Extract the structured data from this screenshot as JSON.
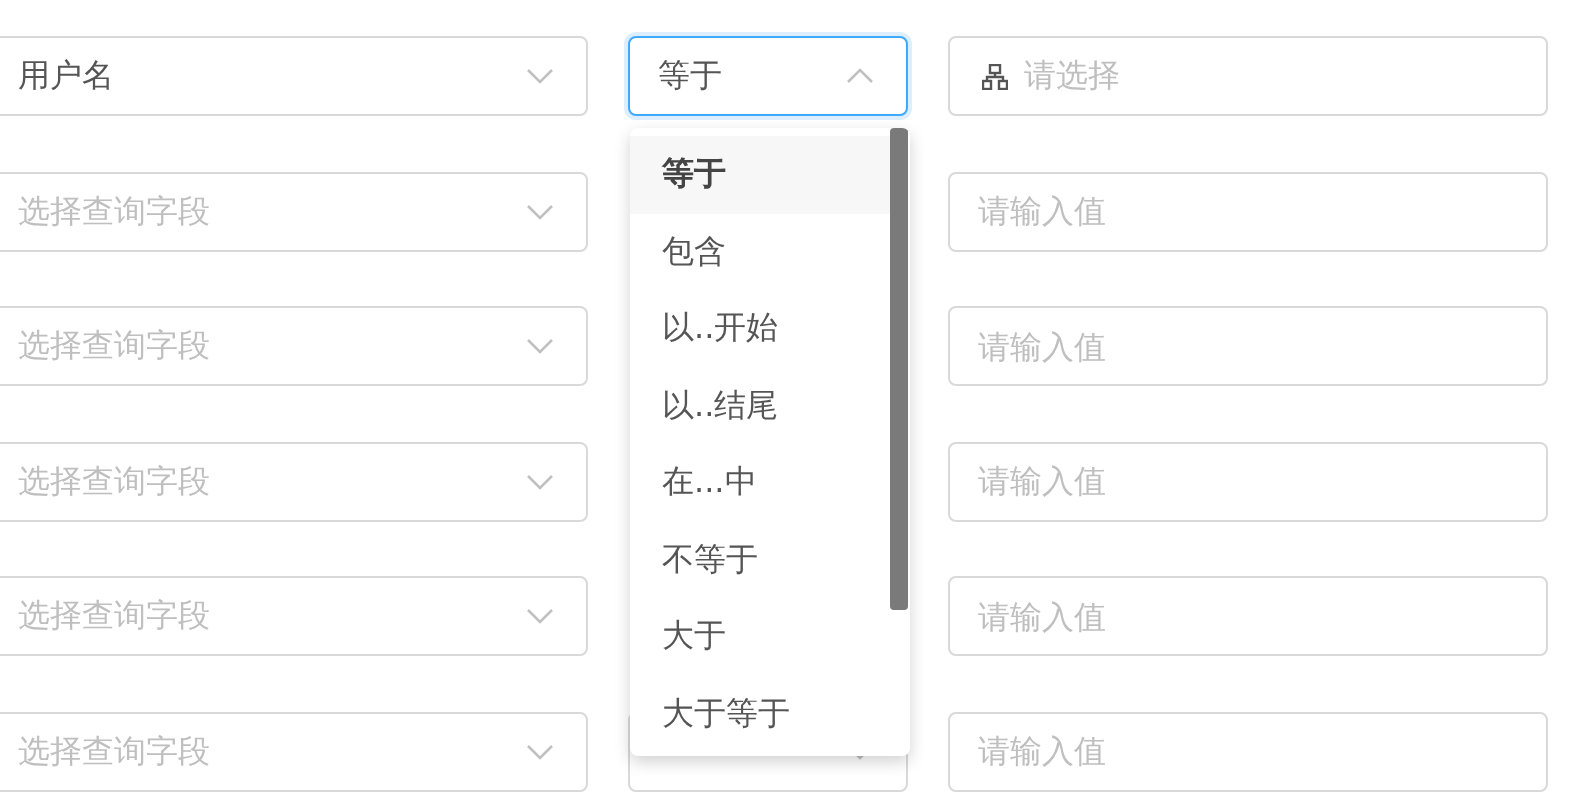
{
  "rows": [
    {
      "field": {
        "value": "用户名"
      },
      "operator": {
        "value": "等于",
        "expanded": true
      },
      "value": {
        "kind": "tree-select",
        "placeholder": "请选择"
      }
    },
    {
      "field": {
        "placeholder": "选择查询字段"
      },
      "value": {
        "kind": "input",
        "placeholder": "请输入值"
      }
    },
    {
      "field": {
        "placeholder": "选择查询字段"
      },
      "value": {
        "kind": "input",
        "placeholder": "请输入值"
      }
    },
    {
      "field": {
        "placeholder": "选择查询字段"
      },
      "value": {
        "kind": "input",
        "placeholder": "请输入值"
      }
    },
    {
      "field": {
        "placeholder": "选择查询字段"
      },
      "value": {
        "kind": "input",
        "placeholder": "请输入值"
      }
    },
    {
      "field": {
        "placeholder": "选择查询字段"
      },
      "operator": {
        "expanded": false
      },
      "value": {
        "kind": "input",
        "placeholder": "请输入值"
      }
    }
  ],
  "dropdown": {
    "options": [
      {
        "label": "等于",
        "selected": true
      },
      {
        "label": "包含",
        "selected": false
      },
      {
        "label": "以..开始",
        "selected": false
      },
      {
        "label": "以..结尾",
        "selected": false
      },
      {
        "label": "在...中",
        "selected": false
      },
      {
        "label": "不等于",
        "selected": false
      },
      {
        "label": "大于",
        "selected": false
      },
      {
        "label": "大于等于",
        "selected": false
      }
    ]
  }
}
